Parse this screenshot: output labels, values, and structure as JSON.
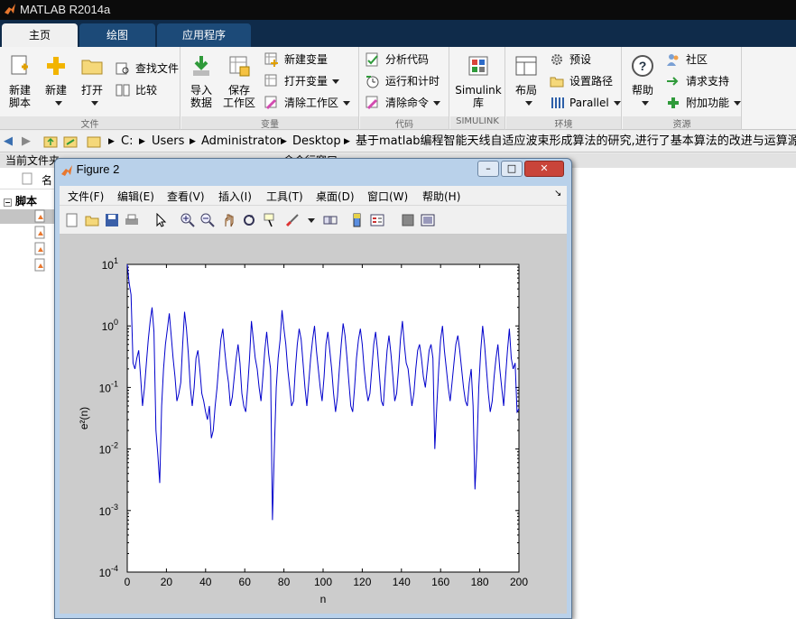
{
  "app": {
    "title": "MATLAB R2014a"
  },
  "ribbon_tabs": [
    {
      "label": "主页",
      "active": true
    },
    {
      "label": "绘图",
      "active": false
    },
    {
      "label": "应用程序",
      "active": false
    }
  ],
  "ribbon": {
    "file": {
      "section_label": "文件",
      "new_script": "新建\n脚本",
      "new": "新建",
      "open": "打开",
      "find_files": "查找文件",
      "compare": "比较"
    },
    "variable": {
      "section_label": "变量",
      "import_data": "导入\n数据",
      "save_workspace": "保存\n工作区",
      "new_variable": "新建变量",
      "open_variable": "打开变量",
      "clear_workspace": "清除工作区"
    },
    "code": {
      "section_label": "代码",
      "analyze_code": "分析代码",
      "run_and_time": "运行和计时",
      "clear_commands": "清除命令"
    },
    "simulink": {
      "section_label": "SIMULINK",
      "simulink_library": "Simulink\n库"
    },
    "environment": {
      "section_label": "环境",
      "layout": "布局",
      "preferences": "预设",
      "set_path": "设置路径",
      "parallel": "Parallel"
    },
    "resources": {
      "section_label": "资源",
      "help": "帮助",
      "community": "社区",
      "request_support": "请求支持",
      "add_ons": "附加功能"
    }
  },
  "address_bar": {
    "crumbs": [
      "C:",
      "Users",
      "Administrator",
      "Desktop",
      "基于matlab编程智能天线自适应波束形成算法的研究,进行了基本算法的改进与运算源码程序"
    ]
  },
  "left_panel": {
    "header": "当前文件夹",
    "column_name": "名",
    "tree_root": "脚本"
  },
  "right_panel": {
    "header": "命令行窗口"
  },
  "figure": {
    "title": "Figure 2",
    "menu": [
      "文件(F)",
      "编辑(E)",
      "查看(V)",
      "插入(I)",
      "工具(T)",
      "桌面(D)",
      "窗口(W)",
      "帮助(H)"
    ],
    "toolbar_icons": [
      "new-figure-icon",
      "open-icon",
      "save-icon",
      "print-icon",
      "pointer-icon",
      "zoom-in-icon",
      "zoom-out-icon",
      "pan-icon",
      "rotate-icon",
      "data-cursor-icon",
      "brush-icon",
      "link-icon",
      "colorbar-icon",
      "legend-icon",
      "hide-plot-tools-icon",
      "show-plot-tools-icon"
    ]
  },
  "chart_data": {
    "type": "line",
    "xlabel": "n",
    "ylabel": "e²(n)",
    "yscale": "log",
    "xlim": [
      0,
      200
    ],
    "ylim": [
      0.0001,
      10
    ],
    "xticks": [
      0,
      20,
      40,
      60,
      80,
      100,
      120,
      140,
      160,
      180,
      200
    ],
    "ytick_labels": [
      {
        "base": "10",
        "exp": "1",
        "value": 10
      },
      {
        "base": "10",
        "exp": "0",
        "value": 1
      },
      {
        "base": "10",
        "exp": "-1",
        "value": 0.1
      },
      {
        "base": "10",
        "exp": "-2",
        "value": 0.01
      },
      {
        "base": "10",
        "exp": "-3",
        "value": 0.001
      },
      {
        "base": "10",
        "exp": "-4",
        "value": 0.0001
      }
    ],
    "grid": false,
    "line_color": "#0000cc",
    "series": [
      {
        "values": [
          10,
          5,
          3.2,
          0.25,
          0.2,
          0.3,
          0.4,
          0.15,
          0.05,
          0.1,
          0.25,
          0.6,
          1.2,
          2,
          0.8,
          0.02,
          0.008,
          0.0028,
          0.05,
          0.2,
          0.5,
          0.9,
          1.6,
          0.7,
          0.3,
          0.15,
          0.06,
          0.08,
          0.12,
          0.5,
          1.7,
          0.9,
          0.35,
          0.1,
          0.05,
          0.1,
          0.3,
          0.4,
          0.2,
          0.08,
          0.06,
          0.04,
          0.03,
          0.05,
          0.015,
          0.02,
          0.05,
          0.1,
          0.25,
          0.6,
          0.9,
          0.4,
          0.2,
          0.12,
          0.05,
          0.07,
          0.15,
          0.3,
          0.5,
          0.25,
          0.08,
          0.05,
          0.04,
          0.1,
          0.3,
          1.2,
          0.6,
          0.3,
          0.2,
          0.1,
          0.06,
          0.15,
          0.4,
          0.8,
          0.35,
          0.2,
          0.0007,
          0.01,
          0.1,
          0.3,
          0.6,
          1.8,
          0.9,
          0.5,
          0.2,
          0.1,
          0.05,
          0.06,
          0.2,
          0.5,
          0.9,
          0.6,
          0.25,
          0.1,
          0.05,
          0.12,
          0.3,
          0.6,
          1,
          0.4,
          0.2,
          0.1,
          0.06,
          0.15,
          0.5,
          0.8,
          0.4,
          0.2,
          0.08,
          0.04,
          0.07,
          0.2,
          0.5,
          1.1,
          0.7,
          0.3,
          0.12,
          0.05,
          0.04,
          0.1,
          0.3,
          0.6,
          0.9,
          0.5,
          0.2,
          0.1,
          0.06,
          0.08,
          0.2,
          0.5,
          0.8,
          0.4,
          0.15,
          0.06,
          0.05,
          0.15,
          0.4,
          0.7,
          0.35,
          0.15,
          0.06,
          0.08,
          0.2,
          0.6,
          1.2,
          0.5,
          0.25,
          0.2,
          0.1,
          0.05,
          0.08,
          0.2,
          0.4,
          0.5,
          0.3,
          0.15,
          0.1,
          0.2,
          0.4,
          0.5,
          0.3,
          0.01,
          0.05,
          0.2,
          0.6,
          1,
          0.4,
          0.2,
          0.1,
          0.06,
          0.12,
          0.25,
          0.5,
          0.7,
          0.4,
          0.2,
          0.1,
          0.06,
          0.05,
          0.12,
          0.2,
          0.05,
          0.0022,
          0.01,
          0.1,
          0.4,
          1,
          0.5,
          0.2,
          0.08,
          0.04,
          0.06,
          0.15,
          0.3,
          0.5,
          0.2,
          0.1,
          0.05,
          0.15,
          0.4,
          0.9,
          0.3,
          0.2,
          0.25,
          0.04,
          0.045
        ]
      }
    ]
  }
}
